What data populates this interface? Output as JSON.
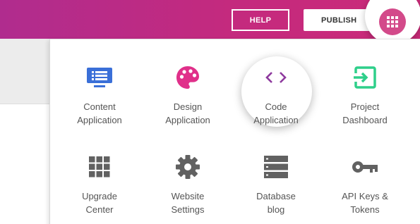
{
  "header": {
    "help_label": "HELP",
    "publish_label": "PUBLISH",
    "apps_icon": "apps-grid-icon",
    "bar_color": "#c42a7e"
  },
  "apps": [
    {
      "icon": "monitor-icon",
      "line1": "Content",
      "line2": "Application",
      "color": "#3a6fd8"
    },
    {
      "icon": "palette-icon",
      "line1": "Design",
      "line2": "Application",
      "color": "#e0308a"
    },
    {
      "icon": "code-icon",
      "line1": "Code",
      "line2": "Application",
      "color": "#8e3a9e"
    },
    {
      "icon": "enter-icon",
      "line1": "Project",
      "line2": "Dashboard",
      "color": "#2ecf8a"
    },
    {
      "icon": "grid-icon",
      "line1": "Upgrade",
      "line2": "Center",
      "color": "#616161"
    },
    {
      "icon": "gear-icon",
      "line1": "Website",
      "line2": "Settings",
      "color": "#616161"
    },
    {
      "icon": "database-icon",
      "line1": "Database",
      "line2": "blog",
      "color": "#616161"
    },
    {
      "icon": "key-icon",
      "line1": "API Keys &",
      "line2": "Tokens",
      "color": "#616161"
    }
  ]
}
